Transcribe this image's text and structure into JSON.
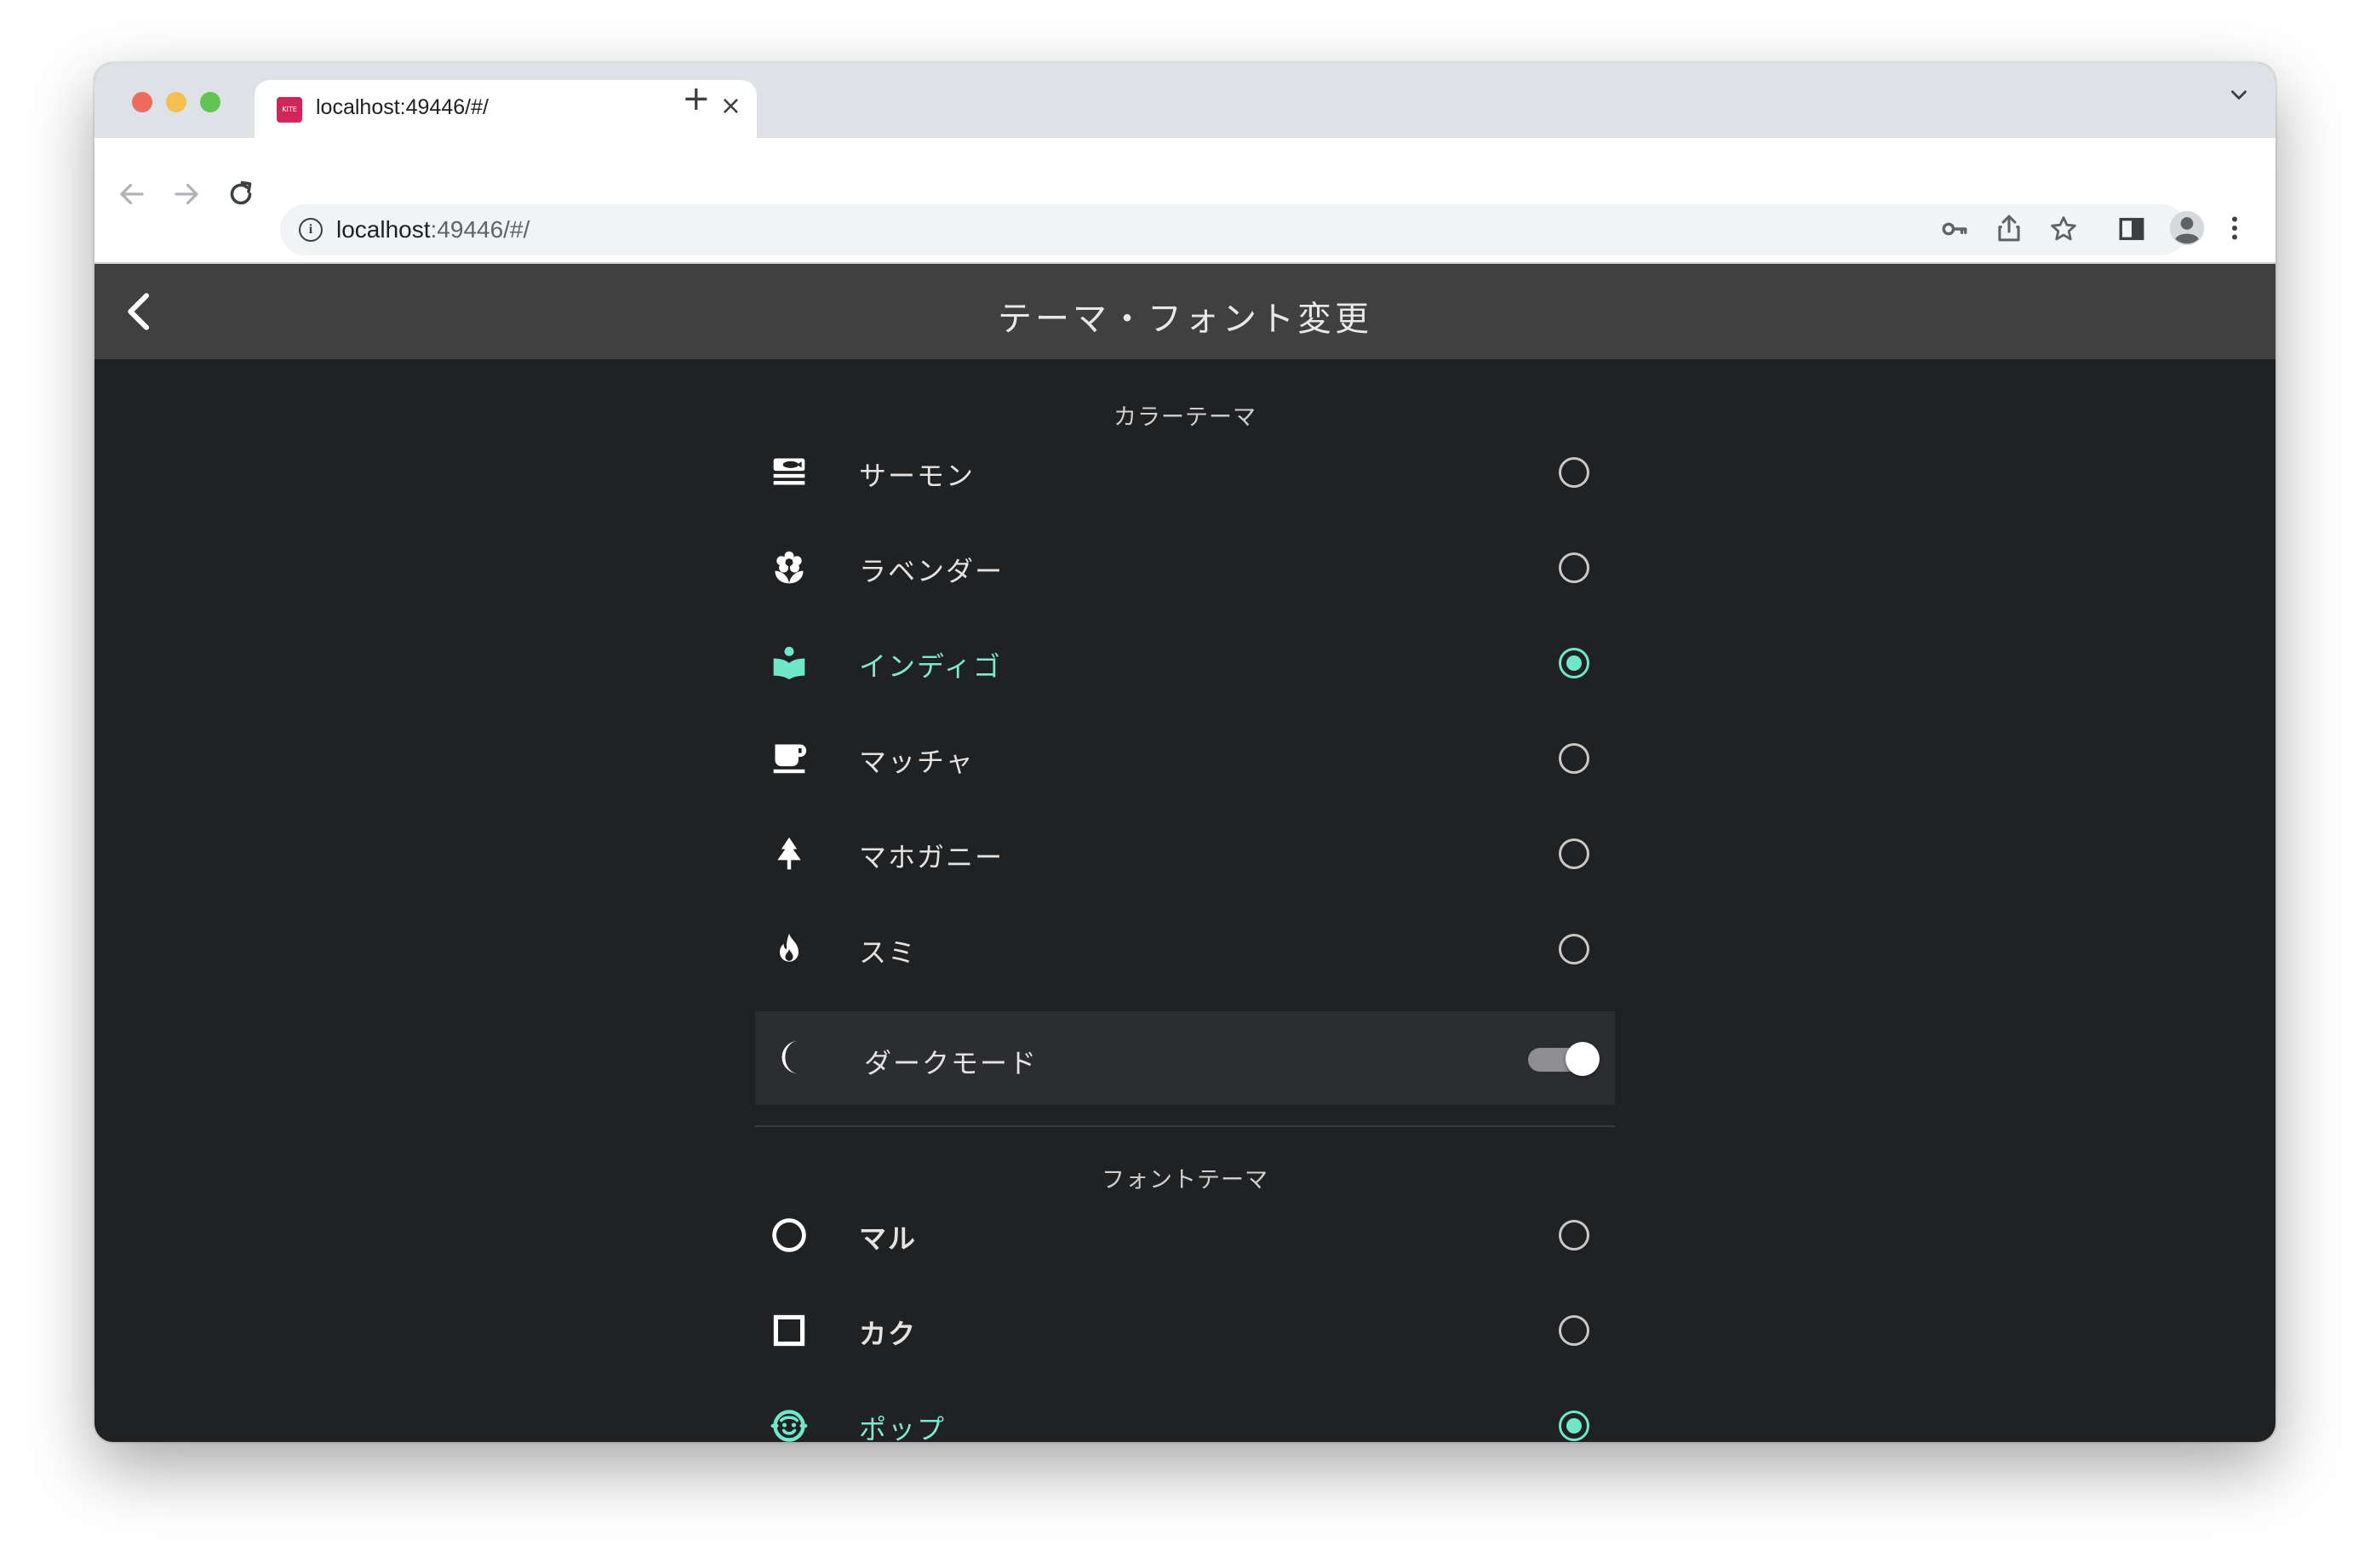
{
  "browser": {
    "tab_title": "localhost:49446/#/",
    "favicon_text": "KITE",
    "url_host": "localhost",
    "url_rest": ":49446/#/",
    "new_tab_symbol": "+",
    "close_tab_symbol": "×"
  },
  "app": {
    "title": "テーマ・フォント変更"
  },
  "color_theme": {
    "header": "カラーテーマ",
    "items": [
      {
        "label": "サーモン",
        "icon": "sushi-icon",
        "selected": false
      },
      {
        "label": "ラベンダー",
        "icon": "flower-icon",
        "selected": false
      },
      {
        "label": "インディゴ",
        "icon": "reading-icon",
        "selected": true
      },
      {
        "label": "マッチャ",
        "icon": "cup-icon",
        "selected": false
      },
      {
        "label": "マホガニー",
        "icon": "tree-icon",
        "selected": false
      },
      {
        "label": "スミ",
        "icon": "flame-icon",
        "selected": false
      }
    ],
    "dark_mode": {
      "label": "ダークモード",
      "icon": "moon-icon",
      "enabled": true
    }
  },
  "font_theme": {
    "header": "フォントテーマ",
    "items": [
      {
        "label": "マル",
        "icon": "circle-icon",
        "selected": false
      },
      {
        "label": "カク",
        "icon": "square-icon",
        "selected": false
      },
      {
        "label": "ポップ",
        "icon": "smiley-icon",
        "selected": true
      }
    ]
  },
  "colors": {
    "accent": "#70e6cb",
    "header_bg": "#404040",
    "page_bg": "#202123"
  }
}
